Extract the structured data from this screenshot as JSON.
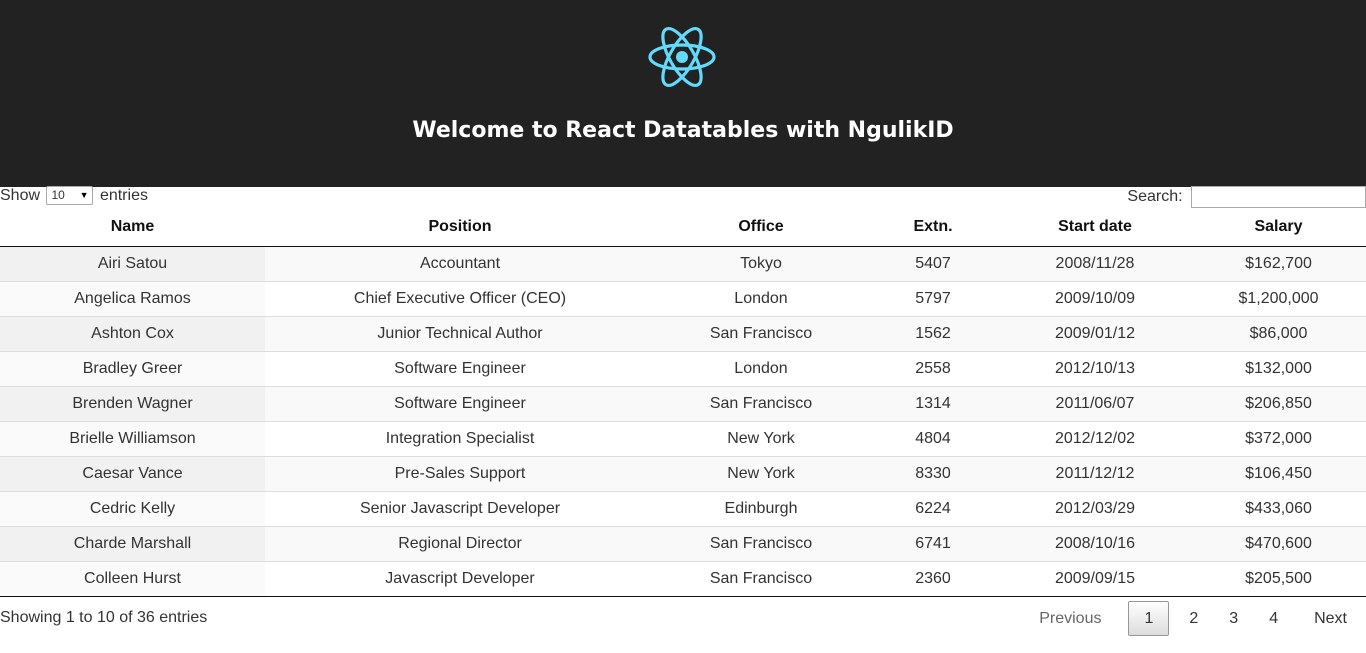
{
  "header": {
    "title": "Welcome to React Datatables with NgulikID",
    "logo_color": "#61dafb",
    "background": "#222222"
  },
  "controls": {
    "show_label": "Show",
    "entries_label": "entries",
    "length_value": "10",
    "search_label": "Search:",
    "search_value": ""
  },
  "table": {
    "columns": [
      "Name",
      "Position",
      "Office",
      "Extn.",
      "Start date",
      "Salary"
    ],
    "rows": [
      [
        "Airi Satou",
        "Accountant",
        "Tokyo",
        "5407",
        "2008/11/28",
        "$162,700"
      ],
      [
        "Angelica Ramos",
        "Chief Executive Officer (CEO)",
        "London",
        "5797",
        "2009/10/09",
        "$1,200,000"
      ],
      [
        "Ashton Cox",
        "Junior Technical Author",
        "San Francisco",
        "1562",
        "2009/01/12",
        "$86,000"
      ],
      [
        "Bradley Greer",
        "Software Engineer",
        "London",
        "2558",
        "2012/10/13",
        "$132,000"
      ],
      [
        "Brenden Wagner",
        "Software Engineer",
        "San Francisco",
        "1314",
        "2011/06/07",
        "$206,850"
      ],
      [
        "Brielle Williamson",
        "Integration Specialist",
        "New York",
        "4804",
        "2012/12/02",
        "$372,000"
      ],
      [
        "Caesar Vance",
        "Pre-Sales Support",
        "New York",
        "8330",
        "2011/12/12",
        "$106,450"
      ],
      [
        "Cedric Kelly",
        "Senior Javascript Developer",
        "Edinburgh",
        "6224",
        "2012/03/29",
        "$433,060"
      ],
      [
        "Charde Marshall",
        "Regional Director",
        "San Francisco",
        "6741",
        "2008/10/16",
        "$470,600"
      ],
      [
        "Colleen Hurst",
        "Javascript Developer",
        "San Francisco",
        "2360",
        "2009/09/15",
        "$205,500"
      ]
    ]
  },
  "footer": {
    "info": "Showing 1 to 10 of 36 entries",
    "previous": "Previous",
    "next": "Next",
    "pages": [
      "1",
      "2",
      "3",
      "4"
    ],
    "current_page": "1"
  }
}
